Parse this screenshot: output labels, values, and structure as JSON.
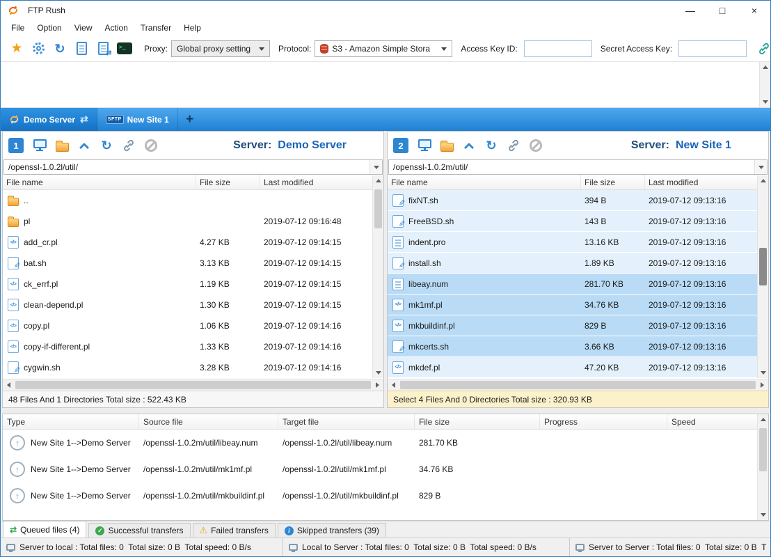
{
  "window": {
    "title": "FTP Rush",
    "controls": {
      "minimize": "—",
      "maximize": "□",
      "close": "×"
    }
  },
  "menu": {
    "items": [
      "File",
      "Option",
      "View",
      "Action",
      "Transfer",
      "Help"
    ]
  },
  "toolbar": {
    "proxy_label": "Proxy:",
    "proxy_value": "Global proxy setting",
    "protocol_label": "Protocol:",
    "protocol_value": "S3 - Amazon Simple Stora",
    "access_key_label": "Access Key ID:",
    "access_key_value": "",
    "secret_key_label": "Secret Access Key:",
    "secret_key_value": ""
  },
  "site_tabs": {
    "tab1": "Demo Server",
    "tab2": "New Site 1",
    "tab2_protocol": "SFTP",
    "new_tab": "+"
  },
  "left_panel": {
    "number": "1",
    "server_label": "Server:",
    "server_name": "Demo Server",
    "path": "/openssl-1.0.2l/util/",
    "columns": [
      "File name",
      "File size",
      "Last modified"
    ],
    "rows": [
      {
        "name": "..",
        "type": "folder",
        "size": "",
        "modified": "",
        "selected": false
      },
      {
        "name": "pl",
        "type": "folder",
        "size": "",
        "modified": "2019-07-12 09:16:48",
        "selected": false
      },
      {
        "name": "add_cr.pl",
        "type": "code",
        "size": "4.27 KB",
        "modified": "2019-07-12 09:14:15",
        "selected": false
      },
      {
        "name": "bat.sh",
        "type": "sh",
        "size": "3.13 KB",
        "modified": "2019-07-12 09:14:15",
        "selected": false
      },
      {
        "name": "ck_errf.pl",
        "type": "code",
        "size": "1.19 KB",
        "modified": "2019-07-12 09:14:15",
        "selected": false
      },
      {
        "name": "clean-depend.pl",
        "type": "code",
        "size": "1.30 KB",
        "modified": "2019-07-12 09:14:15",
        "selected": false
      },
      {
        "name": "copy.pl",
        "type": "code",
        "size": "1.06 KB",
        "modified": "2019-07-12 09:14:16",
        "selected": false
      },
      {
        "name": "copy-if-different.pl",
        "type": "code",
        "size": "1.33 KB",
        "modified": "2019-07-12 09:14:16",
        "selected": false
      },
      {
        "name": "cygwin.sh",
        "type": "sh",
        "size": "3.28 KB",
        "modified": "2019-07-12 09:14:16",
        "selected": false
      }
    ],
    "status": "48 Files And 1 Directories Total size : 522.43 KB"
  },
  "right_panel": {
    "number": "2",
    "server_label": "Server:",
    "server_name": "New Site 1",
    "path": "/openssl-1.0.2m/util/",
    "columns": [
      "File name",
      "File size",
      "Last modified"
    ],
    "rows": [
      {
        "name": "fixNT.sh",
        "type": "sh",
        "size": "394 B",
        "modified": "2019-07-12 09:13:16",
        "selected": false
      },
      {
        "name": "FreeBSD.sh",
        "type": "sh",
        "size": "143 B",
        "modified": "2019-07-12 09:13:16",
        "selected": false
      },
      {
        "name": "indent.pro",
        "type": "doc",
        "size": "13.16 KB",
        "modified": "2019-07-12 09:13:16",
        "selected": false
      },
      {
        "name": "install.sh",
        "type": "sh",
        "size": "1.89 KB",
        "modified": "2019-07-12 09:13:16",
        "selected": false
      },
      {
        "name": "libeay.num",
        "type": "doc",
        "size": "281.70 KB",
        "modified": "2019-07-12 09:13:16",
        "selected": true
      },
      {
        "name": "mk1mf.pl",
        "type": "code",
        "size": "34.76 KB",
        "modified": "2019-07-12 09:13:16",
        "selected": true
      },
      {
        "name": "mkbuildinf.pl",
        "type": "code",
        "size": "829 B",
        "modified": "2019-07-12 09:13:16",
        "selected": true
      },
      {
        "name": "mkcerts.sh",
        "type": "sh",
        "size": "3.66 KB",
        "modified": "2019-07-12 09:13:16",
        "selected": true
      },
      {
        "name": "mkdef.pl",
        "type": "code",
        "size": "47.20 KB",
        "modified": "2019-07-12 09:13:16",
        "selected": false
      }
    ],
    "status": "Select 4 Files And 0 Directories Total size : 320.93 KB"
  },
  "queue": {
    "columns": [
      "Type",
      "Source file",
      "Target file",
      "File size",
      "Progress",
      "Speed"
    ],
    "rows": [
      {
        "type": "New Site 1-->Demo Server",
        "source": "/openssl-1.0.2m/util/libeay.num",
        "target": "/openssl-1.0.2l/util/libeay.num",
        "size": "281.70 KB",
        "progress": "",
        "speed": ""
      },
      {
        "type": "New Site 1-->Demo Server",
        "source": "/openssl-1.0.2m/util/mk1mf.pl",
        "target": "/openssl-1.0.2l/util/mk1mf.pl",
        "size": "34.76 KB",
        "progress": "",
        "speed": ""
      },
      {
        "type": "New Site 1-->Demo Server",
        "source": "/openssl-1.0.2m/util/mkbuildinf.pl",
        "target": "/openssl-1.0.2l/util/mkbuildinf.pl",
        "size": "829 B",
        "progress": "",
        "speed": ""
      }
    ]
  },
  "bottom_tabs": {
    "items": [
      {
        "label": "Queued files (4)",
        "icon": "queue",
        "icon_name": "transfer-queue-icon",
        "active": true
      },
      {
        "label": "Successful transfers",
        "icon": "success",
        "icon_name": "success-check-icon",
        "active": false
      },
      {
        "label": "Failed transfers",
        "icon": "warning",
        "icon_name": "warning-triangle-icon",
        "active": false
      },
      {
        "label": "Skipped transfers (39)",
        "icon": "info",
        "icon_name": "info-circle-icon",
        "active": false
      }
    ]
  },
  "status_bar": {
    "sections": [
      {
        "text": "Server to local : Total files: 0  Total size: 0 B  Total speed: 0 B/s"
      },
      {
        "text": "Local to Server : Total files: 0  Total size: 0 B  Total speed: 0 B/s"
      },
      {
        "text": "Server to Server : Total files: 0  Total size: 0 B  T"
      }
    ]
  },
  "colors": {
    "accent": "#1E7FD3",
    "selection": "#B9DBF6",
    "row_highlight": "#E4F1FC",
    "warning_status_bg": "#FBF2CC",
    "folder": "#F2A33C",
    "tabbar_top": "#4FA8EE",
    "tabbar_bottom": "#1F80D4"
  }
}
